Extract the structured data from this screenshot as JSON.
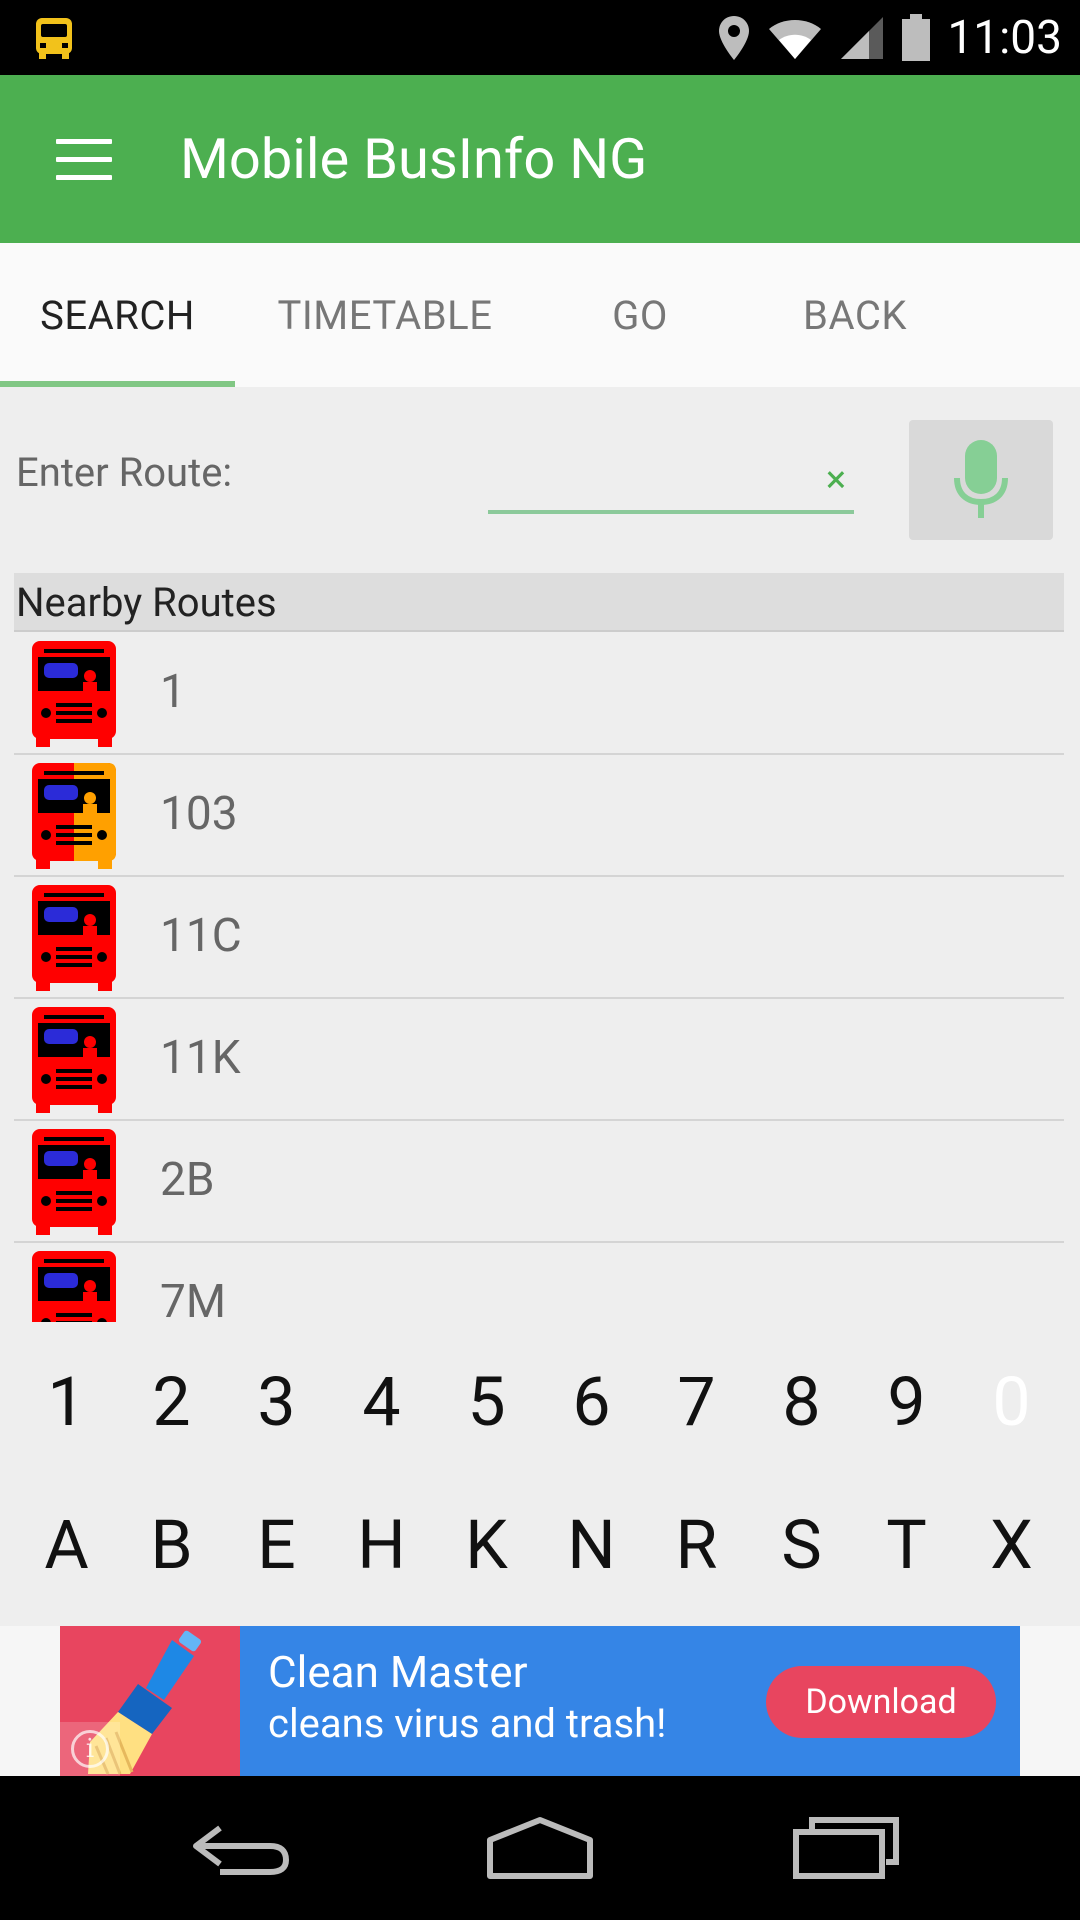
{
  "status_bar": {
    "time": "11:03",
    "icons": [
      "bus-app-icon",
      "location-icon",
      "wifi-icon",
      "signal-icon",
      "battery-icon"
    ]
  },
  "app_bar": {
    "title": "Mobile BusInfo NG",
    "menu_icon": "hamburger-menu-icon",
    "color": "#4caf50"
  },
  "tabs": [
    {
      "label": "SEARCH",
      "active": true
    },
    {
      "label": "TIMETABLE",
      "active": false
    },
    {
      "label": "GO",
      "active": false
    },
    {
      "label": "BACK",
      "active": false
    }
  ],
  "search": {
    "label": "Enter Route:",
    "value": "",
    "clear_symbol": "×",
    "mic_icon": "microphone-icon"
  },
  "nearby": {
    "header": "Nearby Routes",
    "routes": [
      {
        "number": "1",
        "icon": "red-bus-icon"
      },
      {
        "number": "103",
        "icon": "red-orange-bus-icon"
      },
      {
        "number": "11C",
        "icon": "red-bus-icon"
      },
      {
        "number": "11K",
        "icon": "red-bus-icon"
      },
      {
        "number": "2B",
        "icon": "red-bus-icon"
      },
      {
        "number": "7M",
        "icon": "red-bus-icon"
      }
    ]
  },
  "keypad": {
    "digits": [
      "1",
      "2",
      "3",
      "4",
      "5",
      "6",
      "7",
      "8",
      "9",
      "0"
    ],
    "letters": [
      "A",
      "B",
      "E",
      "H",
      "K",
      "N",
      "R",
      "S",
      "T",
      "X"
    ]
  },
  "ad": {
    "line1": "Clean Master",
    "line2": "cleans virus and trash!",
    "cta": "Download",
    "info": "i",
    "colors": {
      "background": "#3585e6",
      "accent": "#e8455f"
    }
  },
  "nav_bar": {
    "buttons": [
      "back-icon",
      "home-icon",
      "recents-icon"
    ]
  }
}
